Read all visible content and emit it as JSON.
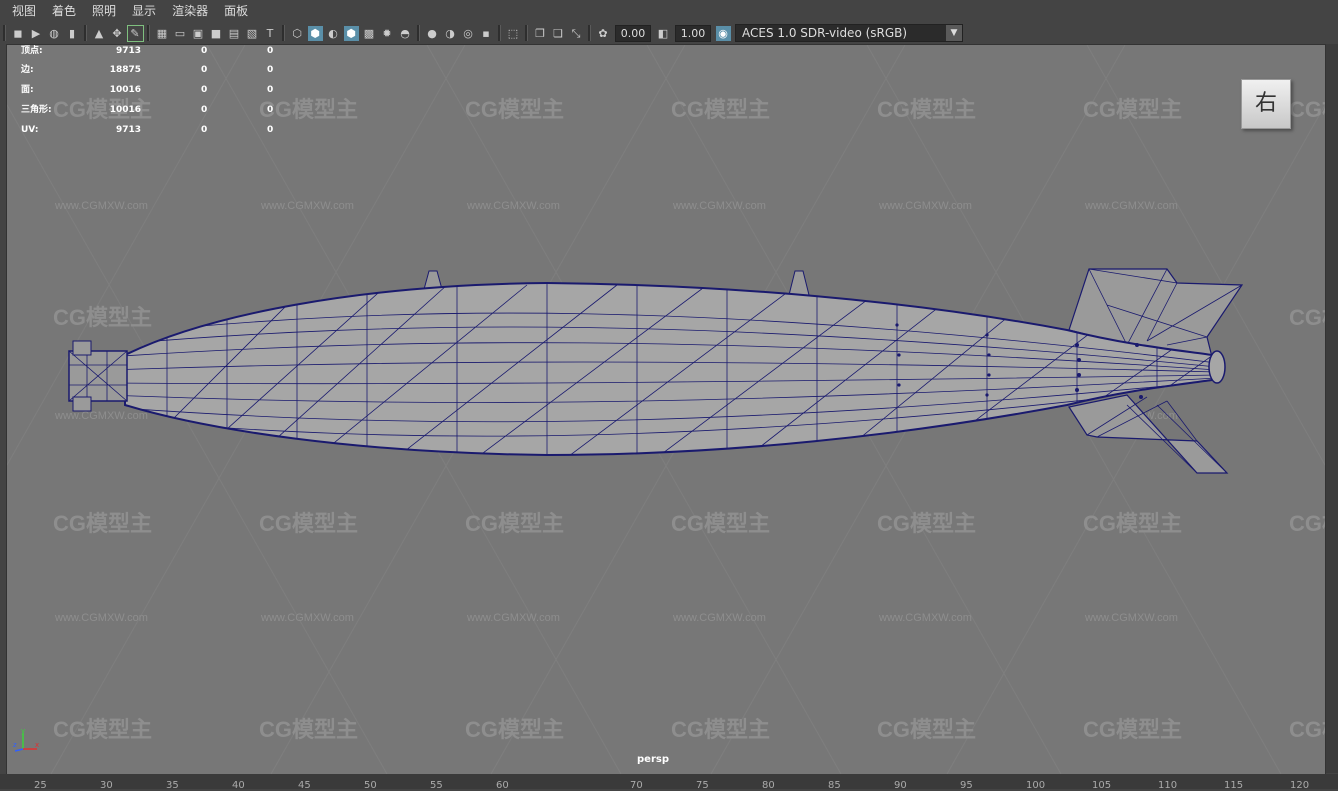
{
  "menu": {
    "items": [
      "视图",
      "着色",
      "照明",
      "显示",
      "渲染器",
      "面板"
    ]
  },
  "toolbar": {
    "exposure_value": "0.00",
    "gamma_value": "1.00",
    "color_space": "ACES 1.0 SDR-video (sRGB)"
  },
  "hud": {
    "rows": [
      {
        "label": "顶点:",
        "v1": "9713",
        "v2": "0",
        "v3": "0"
      },
      {
        "label": "边:",
        "v1": "18875",
        "v2": "0",
        "v3": "0"
      },
      {
        "label": "面:",
        "v1": "10016",
        "v2": "0",
        "v3": "0"
      },
      {
        "label": "三角形:",
        "v1": "10016",
        "v2": "0",
        "v3": "0"
      },
      {
        "label": "UV:",
        "v1": "9713",
        "v2": "0",
        "v3": "0"
      }
    ]
  },
  "viewport": {
    "camera": "persp",
    "viewcube_label": "右",
    "watermark_text": "CG模型主",
    "watermark_url": "www.CGMXW.com",
    "axis_labels": [
      "y",
      "z",
      "x"
    ]
  },
  "ruler": {
    "ticks": [
      "25",
      "30",
      "35",
      "40",
      "45",
      "50",
      "55",
      "60",
      "70",
      "75",
      "80",
      "85",
      "90",
      "95",
      "100",
      "105",
      "110",
      "115",
      "120"
    ]
  },
  "colors": {
    "viewport_bg": "#777777",
    "wireframe": "#1a1a6e",
    "ui_bg": "#444444"
  }
}
